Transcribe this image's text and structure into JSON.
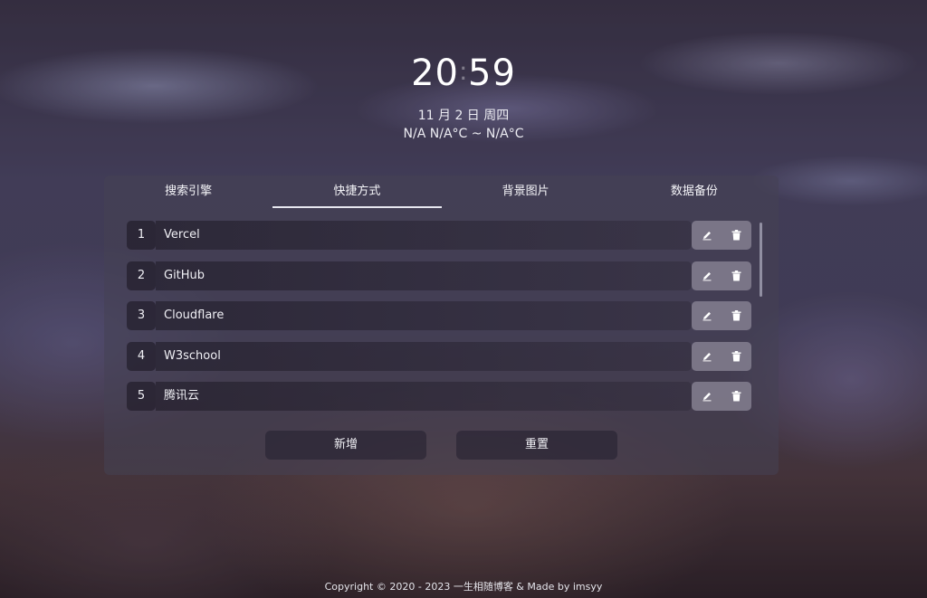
{
  "clock": {
    "hours": "20",
    "minutes": "59"
  },
  "date": "11 月 2 日 周四",
  "weather": "N/A N/A°C ~ N/A°C",
  "tabs": [
    {
      "label": "搜索引擎"
    },
    {
      "label": "快捷方式"
    },
    {
      "label": "背景图片"
    },
    {
      "label": "数据备份"
    }
  ],
  "shortcuts": [
    {
      "index": "1",
      "name": "Vercel"
    },
    {
      "index": "2",
      "name": "GitHub"
    },
    {
      "index": "3",
      "name": "Cloudflare"
    },
    {
      "index": "4",
      "name": "W3school"
    },
    {
      "index": "5",
      "name": "腾讯云"
    }
  ],
  "buttons": {
    "add": "新增",
    "reset": "重置"
  },
  "footer": "Copyright © 2020 - 2023 一生相随博客 &  Made by imsyy",
  "icons": {
    "edit": "edit-pencil-icon",
    "delete": "trash-icon"
  },
  "colors": {
    "panel": "#46425a",
    "text": "#f2f2f6"
  }
}
